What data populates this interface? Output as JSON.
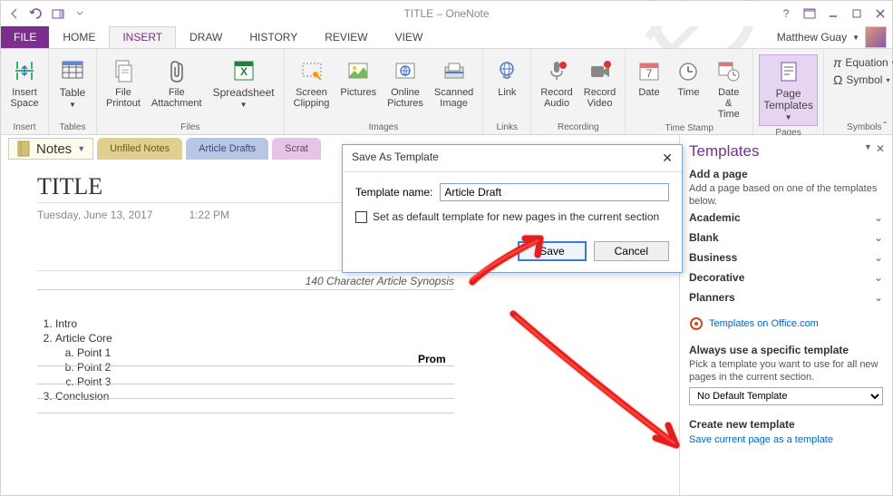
{
  "window": {
    "title": "TITLE – OneNote"
  },
  "account": {
    "name": "Matthew Guay"
  },
  "tabs": {
    "file": "FILE",
    "home": "HOME",
    "insert": "INSERT",
    "draw": "DRAW",
    "history": "HISTORY",
    "review": "REVIEW",
    "view": "VIEW"
  },
  "ribbon": {
    "groups": {
      "insert": {
        "label": "Insert",
        "items": {
          "insert_space": "Insert\nSpace"
        }
      },
      "tables": {
        "label": "Tables",
        "items": {
          "table": "Table"
        }
      },
      "files": {
        "label": "Files",
        "items": {
          "file_printout": "File\nPrintout",
          "file_attachment": "File\nAttachment",
          "spreadsheet": "Spreadsheet"
        }
      },
      "images": {
        "label": "Images",
        "items": {
          "screen_clipping": "Screen\nClipping",
          "pictures": "Pictures",
          "online_pictures": "Online\nPictures",
          "scanned_image": "Scanned\nImage"
        }
      },
      "links": {
        "label": "Links",
        "items": {
          "link": "Link"
        }
      },
      "recording": {
        "label": "Recording",
        "items": {
          "record_audio": "Record\nAudio",
          "record_video": "Record\nVideo"
        }
      },
      "timestamp": {
        "label": "Time Stamp",
        "items": {
          "date": "Date",
          "time": "Time",
          "date_time": "Date &\nTime"
        }
      },
      "pages": {
        "label": "Pages",
        "items": {
          "page_templates": "Page\nTemplates"
        }
      },
      "symbols": {
        "label": "Symbols",
        "items": {
          "equation": "Equation",
          "symbol": "Symbol"
        }
      }
    }
  },
  "notebook": {
    "name": "Notes"
  },
  "sections": {
    "unfiled": "Unfiled Notes",
    "drafts": "Article Drafts",
    "scratch": "Scrat"
  },
  "page": {
    "title": "TITLE",
    "date": "Tuesday, June 13, 2017",
    "time": "1:22 PM",
    "synopsis": "140 Character Article Synopsis",
    "outline": [
      "Intro",
      "Article Core",
      "Conclusion"
    ],
    "points": [
      "Point 1",
      "Point 2",
      "Point 3"
    ],
    "prom": "Prom"
  },
  "dialog": {
    "title": "Save As Template",
    "name_label": "Template name:",
    "name_value": "Article Draft",
    "default_check": "Set as default template for new pages in the current section",
    "save": "Save",
    "cancel": "Cancel"
  },
  "pane": {
    "title": "Templates",
    "add_h": "Add a page",
    "add_p": "Add a page based on one of the templates below.",
    "cats": {
      "academic": "Academic",
      "blank": "Blank",
      "business": "Business",
      "decorative": "Decorative",
      "planners": "Planners"
    },
    "office_link": "Templates on Office.com",
    "always_h": "Always use a specific template",
    "always_p": "Pick a template you want to use for all new pages in the current section.",
    "select_value": "No Default Template",
    "create_h": "Create new template",
    "save_link": "Save current page as a template"
  }
}
